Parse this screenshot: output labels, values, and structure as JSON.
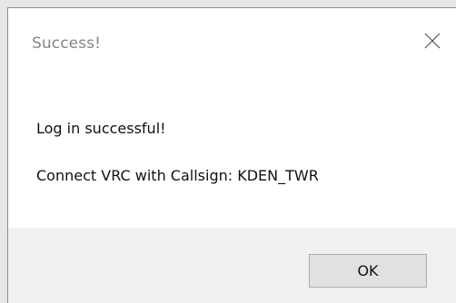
{
  "dialog": {
    "title": "Success!",
    "close_icon": "close-icon",
    "message_primary": "Log in successful!",
    "message_secondary": "Connect VRC with Callsign: KDEN_TWR",
    "ok_label": "OK"
  },
  "colors": {
    "background_outer": "#e6e6e6",
    "dialog_bg": "#ffffff",
    "footer_bg": "#f0f0f0",
    "title_text": "#858585",
    "button_bg": "#e1e1e1",
    "button_border": "#adadad"
  }
}
